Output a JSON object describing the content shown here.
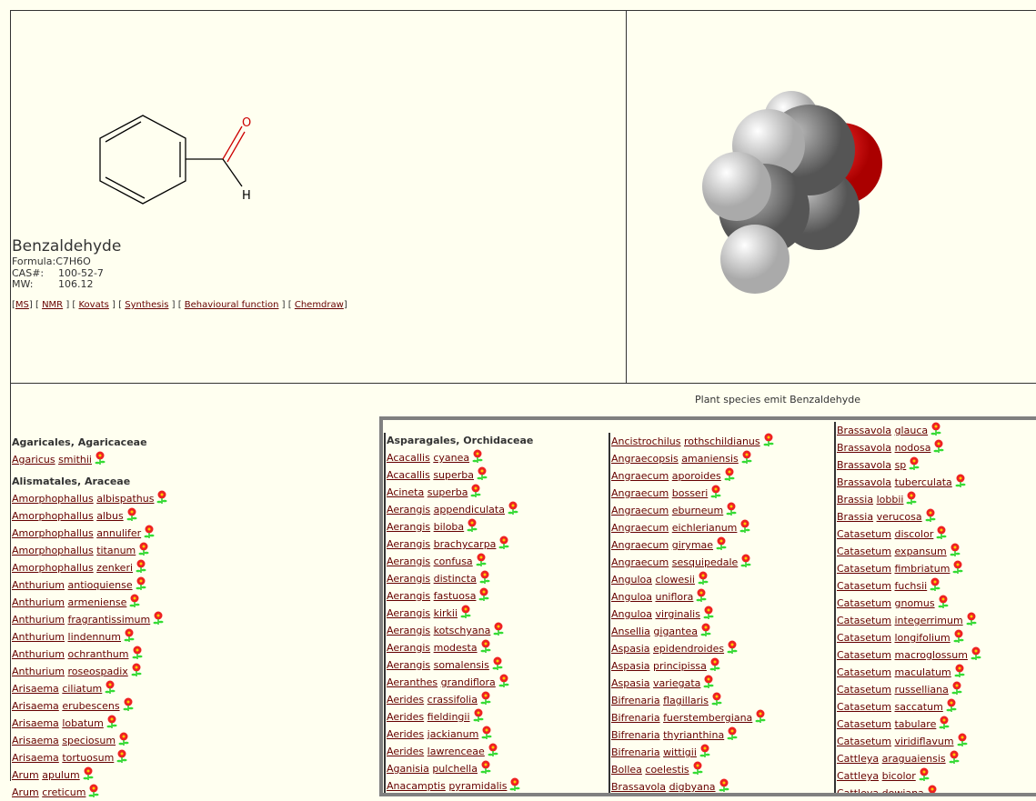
{
  "compound": {
    "name": "Benzaldehyde",
    "formula_label": "Formula:",
    "formula": "C7H6O",
    "cas_label": "CAS#:",
    "cas": "100-52-7",
    "mw_label": "MW:",
    "mw": "106.12",
    "atom_o": "O",
    "atom_h": "H"
  },
  "links": [
    {
      "label": "MS"
    },
    {
      "label": "NMR"
    },
    {
      "label": "Kovats"
    },
    {
      "label": "Synthesis"
    },
    {
      "label": "Behavioural function"
    },
    {
      "label": "Chemdraw"
    }
  ],
  "caption": "Plant species emit Benzaldehyde",
  "colors": {
    "link": "#660000",
    "background": "#fffff0",
    "frame": "#808080",
    "oxygen": "#e00000"
  },
  "icon": "flower-icon",
  "left_column": [
    {
      "header": "Agaricales, Agaricaceae",
      "species": [
        [
          "Agaricus",
          "smithii"
        ]
      ]
    },
    {
      "header": "Alismatales, Araceae",
      "species": [
        [
          "Amorphophallus",
          "albispathus"
        ],
        [
          "Amorphophallus",
          "albus"
        ],
        [
          "Amorphophallus",
          "annulifer"
        ],
        [
          "Amorphophallus",
          "titanum"
        ],
        [
          "Amorphophallus",
          "zenkeri"
        ],
        [
          "Anthurium",
          "antioquiense"
        ],
        [
          "Anthurium",
          "armeniense"
        ],
        [
          "Anthurium",
          "fragrantissimum"
        ],
        [
          "Anthurium",
          "lindennum"
        ],
        [
          "Anthurium",
          "ochranthum"
        ],
        [
          "Anthurium",
          "roseospadix"
        ],
        [
          "Arisaema",
          "ciliatum"
        ],
        [
          "Arisaema",
          "erubescens"
        ],
        [
          "Arisaema",
          "lobatum"
        ],
        [
          "Arisaema",
          "speciosum"
        ],
        [
          "Arisaema",
          "tortuosum"
        ],
        [
          "Arum",
          "apulum"
        ],
        [
          "Arum",
          "creticum"
        ]
      ]
    }
  ],
  "box_columns": [
    {
      "header": "Asparagales, Orchidaceae",
      "species": [
        [
          "Acacallis",
          "cyanea"
        ],
        [
          "Acacallis",
          "superba"
        ],
        [
          "Acineta",
          "superba"
        ],
        [
          "Aerangis",
          "appendiculata"
        ],
        [
          "Aerangis",
          "biloba"
        ],
        [
          "Aerangis",
          "brachycarpa"
        ],
        [
          "Aerangis",
          "confusa"
        ],
        [
          "Aerangis",
          "distincta"
        ],
        [
          "Aerangis",
          "fastuosa"
        ],
        [
          "Aerangis",
          "kirkii"
        ],
        [
          "Aerangis",
          "kotschyana"
        ],
        [
          "Aerangis",
          "modesta"
        ],
        [
          "Aerangis",
          "somalensis"
        ],
        [
          "Aeranthes",
          "grandiflora"
        ],
        [
          "Aerides",
          "crassifolia"
        ],
        [
          "Aerides",
          "fieldingii"
        ],
        [
          "Aerides",
          "jackianum"
        ],
        [
          "Aerides",
          "lawrenceae"
        ],
        [
          "Aganisia",
          "pulchella"
        ],
        [
          "Anacamptis",
          "pyramidalis"
        ]
      ]
    },
    {
      "header": "",
      "species": [
        [
          "Ancistrochilus",
          "rothschildianus"
        ],
        [
          "Angraecopsis",
          "amaniensis"
        ],
        [
          "Angraecum",
          "aporoides"
        ],
        [
          "Angraecum",
          "bosseri"
        ],
        [
          "Angraecum",
          "eburneum"
        ],
        [
          "Angraecum",
          "eichlerianum"
        ],
        [
          "Angraecum",
          "girymae"
        ],
        [
          "Angraecum",
          "sesquipedale"
        ],
        [
          "Anguloa",
          "clowesii"
        ],
        [
          "Anguloa",
          "uniflora"
        ],
        [
          "Anguloa",
          "virginalis"
        ],
        [
          "Ansellia",
          "gigantea"
        ],
        [
          "Aspasia",
          "epidendroides"
        ],
        [
          "Aspasia",
          "principissa"
        ],
        [
          "Aspasia",
          "variegata"
        ],
        [
          "Bifrenaria",
          "flagillaris"
        ],
        [
          "Bifrenaria",
          "fuerstembergiana"
        ],
        [
          "Bifrenaria",
          "thyrianthina"
        ],
        [
          "Bifrenaria",
          "wittigii"
        ],
        [
          "Bollea",
          "coelestis"
        ],
        [
          "Brassavola",
          "digbyana"
        ]
      ]
    },
    {
      "header": "",
      "species": [
        [
          "Brassavola",
          "glauca"
        ],
        [
          "Brassavola",
          "nodosa"
        ],
        [
          "Brassavola",
          "sp"
        ],
        [
          "Brassavola",
          "tuberculata"
        ],
        [
          "Brassia",
          "lobbii"
        ],
        [
          "Brassia",
          "verucosa"
        ],
        [
          "Catasetum",
          "discolor"
        ],
        [
          "Catasetum",
          "expansum"
        ],
        [
          "Catasetum",
          "fimbriatum"
        ],
        [
          "Catasetum",
          "fuchsii"
        ],
        [
          "Catasetum",
          "gnomus"
        ],
        [
          "Catasetum",
          "integerrimum"
        ],
        [
          "Catasetum",
          "longifolium"
        ],
        [
          "Catasetum",
          "macroglossum"
        ],
        [
          "Catasetum",
          "maculatum"
        ],
        [
          "Catasetum",
          "russelliana"
        ],
        [
          "Catasetum",
          "saccatum"
        ],
        [
          "Catasetum",
          "tabulare"
        ],
        [
          "Catasetum",
          "viridiflavum"
        ],
        [
          "Cattleya",
          "araguaiensis"
        ],
        [
          "Cattleya",
          "bicolor"
        ],
        [
          "Cattleya",
          "dowiana"
        ]
      ]
    }
  ]
}
